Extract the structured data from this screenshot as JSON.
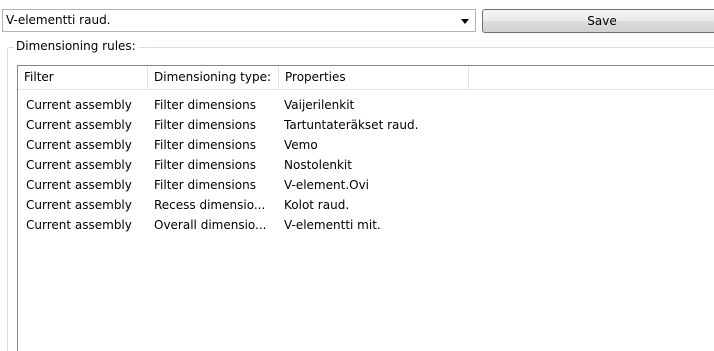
{
  "selector": {
    "value": "V-elementti raud."
  },
  "toolbar": {
    "save_label": "Save"
  },
  "rules_group": {
    "title": "Dimensioning rules:"
  },
  "rules_table": {
    "columns": [
      "Filter",
      "Dimensioning type:",
      "Properties"
    ],
    "rows": [
      [
        "Current assembly",
        "Filter dimensions",
        "Vaijerilenkit"
      ],
      [
        "Current assembly",
        "Filter dimensions",
        "Tartuntateräkset raud."
      ],
      [
        "Current assembly",
        "Filter dimensions",
        "Vemo"
      ],
      [
        "Current assembly",
        "Filter dimensions",
        "Nostolenkit"
      ],
      [
        "Current assembly",
        "Filter dimensions",
        "V-element.Ovi"
      ],
      [
        "Current assembly",
        "Recess dimensio...",
        "Kolot raud."
      ],
      [
        "Current assembly",
        "Overall dimensio...",
        "V-elementti mit."
      ]
    ]
  }
}
